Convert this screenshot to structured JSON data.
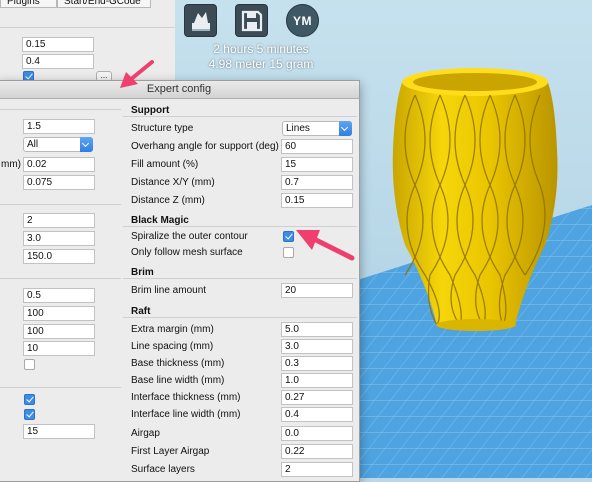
{
  "tabs": [
    "Plugins",
    "Start/End-GCode"
  ],
  "viewport": {
    "buttons": [
      {
        "name": "load-model",
        "icon": "load-icon"
      },
      {
        "name": "save",
        "icon": "floppy-disk-icon"
      },
      {
        "name": "ym",
        "label": "YM"
      }
    ],
    "print_time": "2 hours 5 minutes",
    "print_material": "4.98 meter 15 gram",
    "model_color": "#f4d000",
    "floor_color": "#4fa3e0"
  },
  "main_panel": {
    "fields_top": [
      "0.15",
      "0.4"
    ],
    "dots_label": "..."
  },
  "dialog": {
    "title": "Expert config",
    "left_fields": {
      "g1": [
        "1.5"
      ],
      "g1_select": "All",
      "g1_unit": "mm)",
      "g1_more": [
        "0.02",
        "0.075"
      ],
      "g2": [
        "2",
        "3.0",
        "150.0"
      ],
      "g3": [
        "0.5",
        "100",
        "100",
        "10"
      ],
      "g4_field": "15"
    },
    "support": {
      "heading": "Support",
      "structure_type_label": "Structure type",
      "structure_type_value": "Lines",
      "overhang_label": "Overhang angle for support (deg)",
      "overhang_value": "60",
      "fill_label": "Fill amount (%)",
      "fill_value": "15",
      "dxy_label": "Distance X/Y (mm)",
      "dxy_value": "0.7",
      "dz_label": "Distance Z (mm)",
      "dz_value": "0.15"
    },
    "black_magic": {
      "heading": "Black Magic",
      "spiralize_label": "Spiralize the outer contour",
      "spiralize_checked": true,
      "mesh_label": "Only follow mesh surface",
      "mesh_checked": false
    },
    "brim": {
      "heading": "Brim",
      "line_amount_label": "Brim line amount",
      "line_amount_value": "20"
    },
    "raft": {
      "heading": "Raft",
      "rows": [
        {
          "label": "Extra margin (mm)",
          "value": "5.0"
        },
        {
          "label": "Line spacing (mm)",
          "value": "3.0"
        },
        {
          "label": "Base thickness (mm)",
          "value": "0.3"
        },
        {
          "label": "Base line width (mm)",
          "value": "1.0"
        },
        {
          "label": "Interface thickness (mm)",
          "value": "0.27"
        },
        {
          "label": "Interface line width (mm)",
          "value": "0.4"
        },
        {
          "label": "Airgap",
          "value": "0.0"
        },
        {
          "label": "First Layer Airgap",
          "value": "0.22"
        },
        {
          "label": "Surface layers",
          "value": "2"
        }
      ]
    }
  },
  "annotation_color": "#ee3f6e"
}
